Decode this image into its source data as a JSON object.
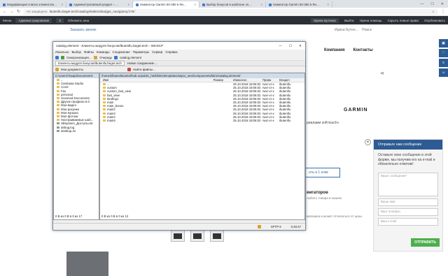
{
  "browser": {
    "tabs": [
      {
        "label": "Модификация списка элементов…"
      },
      {
        "label": "Административный раздел – …"
      },
      {
        "label": "Навигатор Garmin 50-350 в Ян…"
      },
      {
        "label": "Выбор бонусов в шаблоне эл…"
      },
      {
        "label": "Навигатор Garmin 50-350 в Ян…"
      }
    ],
    "security": "Не защищено",
    "url": "ibutenllu.beget.tech/catalog/elaktronika/gps_navigatory/176/",
    "window_min": "—",
    "window_max": "☐",
    "window_close": "✕"
  },
  "admin_bar": {
    "menu": "Меню",
    "mode": "Администрирование",
    "count": "3",
    "refresh": "Обновить кеш",
    "user": "Ирина Бутенко",
    "exit": "Выйти",
    "help": "Нужна помощь",
    "checkbox": "Скрыть левые права",
    "publish": "Опубликовать"
  },
  "site": {
    "order_call": "Заказать звонок",
    "user": "Ирина Бутен...",
    "search": "Поиск",
    "menu": [
      "Компания",
      "Контакты"
    ],
    "brand": "GARMIN",
    "product_text": "риалами soft-touch»",
    "buy_button": "ить в 1 клик",
    "nav_heading": "вигаторов",
    "nav_sub": "любого товара в нашем",
    "nav_sub2": "магазина и может отличаться от цены"
  },
  "chat": {
    "title": "Отправьте нам сообщение",
    "desc": "Оставьте свое сообщение в этой форме, мы получим его на e-mail и обязательно ответим!",
    "fields": [
      "Ваше сообщение*",
      "Ваше имя",
      "Ваш телефон",
      "Ваш e-mail"
    ],
    "send": "ОТПРАВИТЬ"
  },
  "winscp": {
    "title": "catalog.element - Клиенты модуля бонусов/ibutenllu.beget.tech - WinSCP",
    "menu": [
      "Локально",
      "Выбор",
      "Файлы",
      "Команды",
      "Соединение",
      "Параметры",
      "Сервер",
      "Справка"
    ],
    "toolbar": [
      "Синхронизация…",
      "Очередь",
      "catalog.element"
    ],
    "session": "Клиенты модуля бонусов/ibutenllu.beget.tech",
    "new_session": "Новое соединение…",
    "left_docs": "Мои документы",
    "find_files": "Найти файлы…",
    "left_path": "C:\\Users\\Тахир\\Documents\\",
    "right_path": "/home/i/ibutenllu/antehhub.ru/public_html/bitrix/templates/aspro_next/components/bitrix/catalog.element/",
    "left_tree": [
      "..",
      "Camtasia Studio",
      "Corel",
      "Fax",
      "personal",
      "Scanned Documents",
      "Другие профили 6.0",
      "Мои видео",
      "Мои рисунки",
      "Моя музыка",
      "Моя фотоки",
      "Настраиваемые шаб...",
      "SBsystem_Доступы.txt",
      "debug.log",
      "desktop.ini"
    ],
    "columns": [
      "Имя",
      "Размер",
      "Изменено",
      "Права",
      "Владел"
    ],
    "rows": [
      {
        "name": "..",
        "size": "",
        "date": "25.10.2018 18:06:02",
        "rights": "rwxr-xr-x",
        "owner": "ibutenllu"
      },
      {
        "name": "custom",
        "size": "",
        "date": "25.10.2018 18:06:02",
        "rights": "rwxr-xr-x",
        "owner": "ibutenllu"
      },
      {
        "name": "custom_fast_view",
        "size": "",
        "date": "25.10.2018 18:06:02",
        "rights": "rwxr-xr-x",
        "owner": "ibutenllu"
      },
      {
        "name": "fast_view",
        "size": "",
        "date": "25.10.2018 18:06:02",
        "rights": "rwxr-xr-x",
        "owner": "ibutenllu"
      },
      {
        "name": "landing1",
        "size": "",
        "date": "25.10.2018 18:06:02",
        "rights": "rwxr-xr-x",
        "owner": "ibutenllu"
      },
      {
        "name": "main",
        "size": "",
        "date": "25.10.2018 18:06:02",
        "rights": "rwxr-xr-x",
        "owner": "ibutenllu"
      },
      {
        "name": "main_bonus",
        "size": "",
        "date": "25.10.2018 18:06:02",
        "rights": "rwxr-xr-x",
        "owner": "ibutenllu"
      },
      {
        "name": "main2",
        "size": "",
        "date": "25.10.2018 18:06:02",
        "rights": "rwxr-xr-x",
        "owner": "ibutenllu"
      },
      {
        "name": "main3",
        "size": "",
        "date": "25.10.2018 18:06:02",
        "rights": "rwxr-xr-x",
        "owner": "ibutenllu"
      },
      {
        "name": "main4",
        "size": "",
        "date": "25.10.2018 18:06:02",
        "rights": "rwxr-xr-x",
        "owner": "ibutenllu"
      },
      {
        "name": "main5",
        "size": "",
        "date": "25.10.2018 18:06:02",
        "rights": "rwxr-xr-x",
        "owner": "ibutenllu"
      }
    ],
    "left_status": "0 B из 0 B в 0 из 17",
    "right_status": "0 B из 0 B в 0 из 12",
    "protocol": "SFTP-3",
    "time": "0:40:47"
  }
}
